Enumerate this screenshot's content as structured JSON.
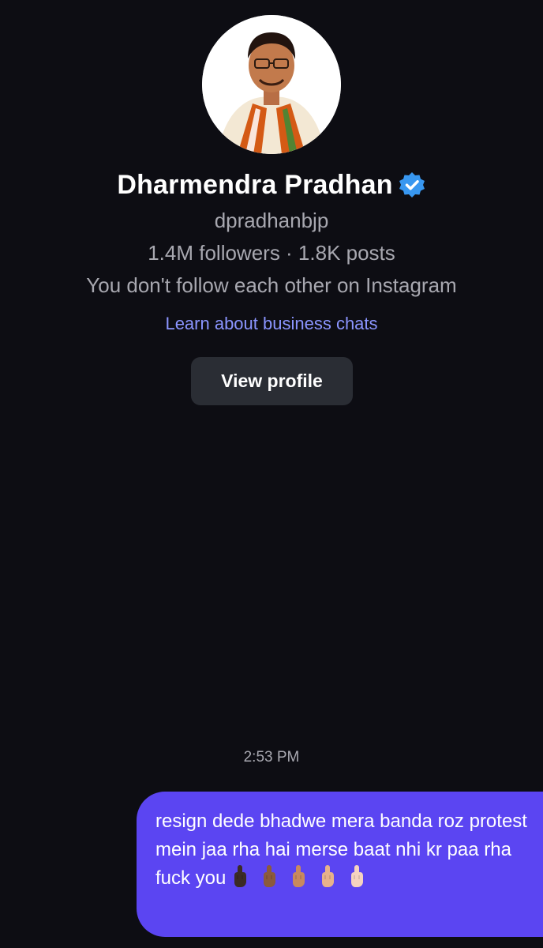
{
  "profile": {
    "display_name": "Dharmendra Pradhan",
    "verified_icon": "verified-badge-icon",
    "username": "dpradhanbjp",
    "stats": "1.4M followers · 1.8K posts",
    "relationship": "You don't follow each other on Instagram",
    "business_link": "Learn about business chats",
    "view_profile_label": "View profile"
  },
  "conversation": {
    "timestamp": "2:53 PM",
    "messages": [
      {
        "text": "resign dede bhadwe mera banda roz protest mein jaa rha hai merse baat nhi kr paa rha fuck you",
        "emoji_icon": "middle-finger-emoji-icon",
        "emoji_skin_tones": [
          "#3b2b25",
          "#8b5a3c",
          "#c8895f",
          "#e7b28b",
          "#f5d3c0"
        ]
      }
    ]
  },
  "colors": {
    "background": "#0d0d13",
    "bubble": "#5b45f2",
    "link": "#8b95ff",
    "verified": "#3897f0",
    "button": "#2a2d34"
  }
}
